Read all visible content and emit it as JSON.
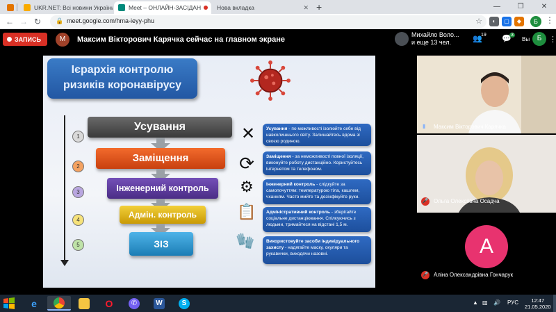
{
  "browser": {
    "tabs": [
      {
        "title": "UKR.NET: Всі новини України, о",
        "active": false
      },
      {
        "title": "Meet – ОНЛАЙН-ЗАСІДАН",
        "active": true
      },
      {
        "title": "Нова вкладка",
        "active": false
      }
    ],
    "url": "meet.google.com/hma-ieyy-phu",
    "profile_initial": "Б",
    "new_tab_glyph": "+"
  },
  "meet": {
    "record_label": "ЗАПИСЬ",
    "presenter_initial": "М",
    "presenter_text": "Максим Вікторович Карячка сейчас на главном экране",
    "pinned_name": "Михайло Воло...",
    "pinned_more": "и еще 13 чел.",
    "people_count": "19",
    "chat_count": "3",
    "you_label": "Вы",
    "you_initial": "Б"
  },
  "slide": {
    "title_line1": "Ієрархія контролю",
    "title_line2": "ризиків коронавірусу",
    "numbers": [
      "1",
      "2",
      "3",
      "4",
      "5"
    ],
    "tiers": [
      {
        "label": "Усування",
        "color": "#4b4b4b"
      },
      {
        "label": "Заміщення",
        "color": "#e8531e"
      },
      {
        "label": "Інженерний контроль",
        "color": "#5b3a9a"
      },
      {
        "label": "Адмін. контроль",
        "color": "#e2b714"
      },
      {
        "label": "ЗІЗ",
        "color": "#2a8fc8"
      }
    ],
    "icons": [
      "close-x-icon",
      "refresh-cycle-icon",
      "gears-icon",
      "clipboard-checklist-icon",
      "gloves-icon"
    ],
    "descriptions": [
      {
        "head": "Усування",
        "body": " - по можливості ізолюйте себе від навколишнього світу. Залишайтесь вдома зі своєю родиною."
      },
      {
        "head": "Заміщення",
        "body": " - за неможливості повної ізоляції, виконуйте роботу дистанційно. Користуйтесь інтернетом та телефоном."
      },
      {
        "head": "Інженерний контроль",
        "body": " - слідкуйте за самопочуттям: температурою тіла, кашлем, чханням. Часто мийте та дезінфікуйте руки."
      },
      {
        "head": "Адміністративний контроль",
        "body": " - зберігайте соціальне дистанціювання. Спілкуючись з людьми, тримайтеся на відстані 1,5 м."
      },
      {
        "head": "Використовуйте засоби індивідуального захисту",
        "body": " - надягайте маску, окуляри та рукавички, виходячи назовні."
      }
    ]
  },
  "participants": [
    {
      "name": "Максим Вікторович Карячка",
      "muted": false
    },
    {
      "name": "Ольга Олексіївна Осадча",
      "muted": true
    },
    {
      "name": "Аліна Олександрівна Гончарук",
      "muted": true,
      "initial": "А"
    }
  ],
  "taskbar": {
    "lang": "РУС",
    "time": "12:47",
    "date": "21.05.2020"
  }
}
